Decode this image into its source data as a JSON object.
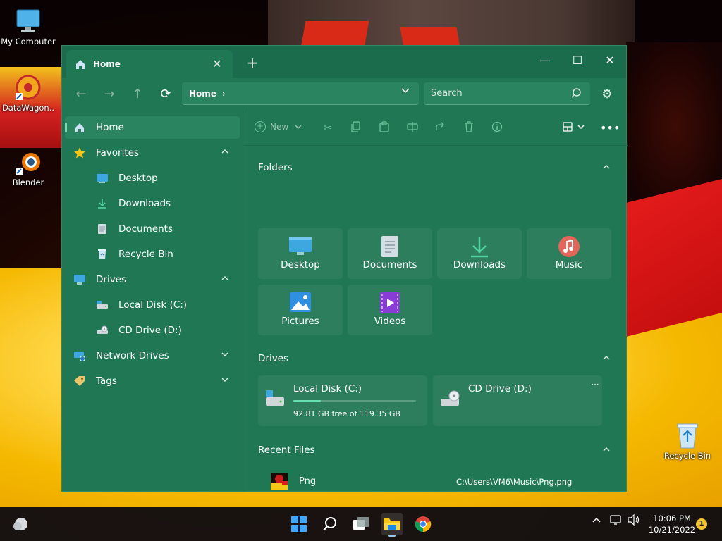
{
  "desktop": {
    "icons": [
      {
        "label": "My Computer"
      },
      {
        "label": "DataWagon.."
      },
      {
        "label": "Blender"
      },
      {
        "label": "Recycle Bin"
      }
    ]
  },
  "window": {
    "tab": {
      "title": "Home",
      "close": "✕"
    },
    "new_tab": "+",
    "controls": {
      "minimize": "—",
      "maximize": "☐",
      "close": "✕"
    },
    "address": {
      "crumb": "Home",
      "chevron": "›",
      "dropdown": "⌄"
    },
    "search": {
      "placeholder": "Search"
    }
  },
  "sidebar": {
    "items": [
      {
        "label": "Home"
      },
      {
        "label": "Favorites"
      },
      {
        "label": "Desktop"
      },
      {
        "label": "Downloads"
      },
      {
        "label": "Documents"
      },
      {
        "label": "Recycle Bin"
      },
      {
        "label": "Drives"
      },
      {
        "label": "Local Disk (C:)"
      },
      {
        "label": "CD Drive (D:)"
      },
      {
        "label": "Network Drives"
      },
      {
        "label": "Tags"
      }
    ]
  },
  "commandbar": {
    "new_label": "New"
  },
  "sections": {
    "folders": "Folders",
    "drives": "Drives",
    "recent": "Recent Files"
  },
  "folders": [
    {
      "label": "Desktop"
    },
    {
      "label": "Documents"
    },
    {
      "label": "Downloads"
    },
    {
      "label": "Music"
    },
    {
      "label": "Pictures"
    },
    {
      "label": "Videos"
    }
  ],
  "drives": [
    {
      "name": "Local Disk (C:)",
      "free_text": "92.81 GB free of 119.35 GB",
      "used_fraction": 0.223
    },
    {
      "name": "CD Drive (D:)",
      "more": "···"
    }
  ],
  "recent_files": [
    {
      "name": "Png",
      "path": "C:\\Users\\VM6\\Music\\Png.png"
    }
  ],
  "taskbar": {
    "time": "10:06 PM",
    "date": "10/21/2022",
    "notifications": "1"
  },
  "colors": {
    "window_bg": "#1f7754",
    "accent": "#67e0b2"
  }
}
